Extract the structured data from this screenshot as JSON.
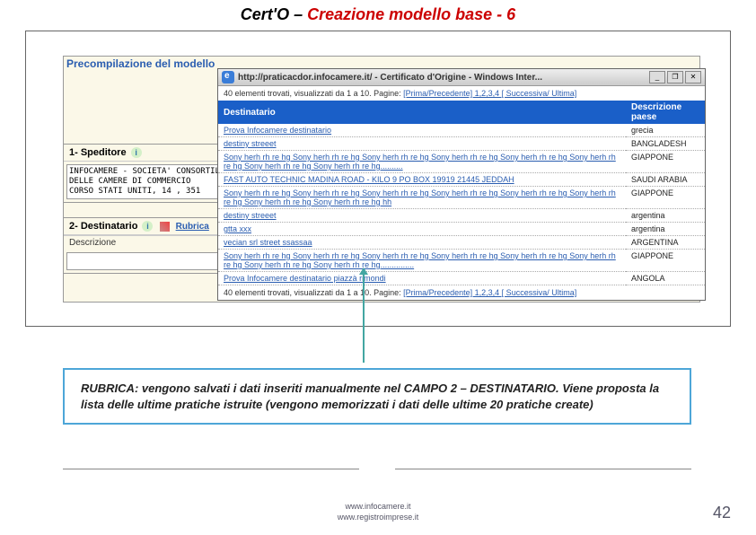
{
  "title": {
    "prefix": "Cert'O – ",
    "highlight": "Creazione modello base - 6"
  },
  "precomp_label": "Precompilazione del modello",
  "speditore": {
    "header": "1- Speditore",
    "value": "INFOCAMERE - SOCIETA' CONSORTILE\nDELLE CAMERE DI COMMERCIO\nCORSO STATI UNITI, 14 , 351"
  },
  "destinatario": {
    "header": "2- Destinatario",
    "rubrica_label": "Rubrica",
    "descrizione_label": "Descrizione"
  },
  "popup": {
    "title": "http://praticacdor.infocamere.it/ - Certificato d'Origine - Windows Inter...",
    "pager_pre": "40 elementi trovati, visualizzati da 1 a 10. Pagine: ",
    "pager_links": "[Prima/Precedente] 1,2,3,4 [ Successiva/ Ultima]",
    "col_dest": "Destinatario",
    "col_paese": "Descrizione paese",
    "rows": [
      {
        "dest": "Prova Infocamere destinatario",
        "paese": "grecia"
      },
      {
        "dest": "destiny streeet",
        "paese": "BANGLADESH"
      },
      {
        "dest": "Sony herh rh re hg Sony herh rh re hg Sony herh rh re hg Sony herh rh re hg Sony herh rh re hg Sony herh rh re hg Sony herh rh re hg Sony herh rh re hg..........",
        "paese": "GIAPPONE"
      },
      {
        "dest": "FAST AUTO TECHNIC MADINA ROAD - KILO 9 PO BOX 19919 21445 JEDDAH",
        "paese": "SAUDI ARABIA"
      },
      {
        "dest": "Sony herh rh re hg Sony herh rh re hg Sony herh rh re hg Sony herh rh re hg Sony herh rh re hg Sony herh rh re hg Sony herh rh re hg Sony herh rh re hg hh",
        "paese": "GIAPPONE"
      },
      {
        "dest": "destiny streeet",
        "paese": "argentina"
      },
      {
        "dest": "gtta xxx",
        "paese": "argentina"
      },
      {
        "dest": "vecian srl street ssassaa",
        "paese": "ARGENTINA"
      },
      {
        "dest": "Sony herh rh re hg Sony herh rh re hg Sony herh rh re hg Sony herh rh re hg Sony herh rh re hg Sony herh rh re hg Sony herh rh re hg Sony herh rh re hg...............",
        "paese": "GIAPPONE"
      },
      {
        "dest": "Prova Infocamere destinatario piazzà rimondi",
        "paese": "ANGOLA"
      }
    ]
  },
  "callout": "RUBRICA: vengono salvati i dati inseriti manualmente nel CAMPO 2 – DESTINATARIO. Viene proposta la lista delle ultime pratiche istruite (vengono memorizzati i dati delle ultime 20 pratiche create)",
  "footer": {
    "line1": "www.infocamere.it",
    "line2": "www.registroimprese.it"
  },
  "page_number": "42",
  "win_btns": {
    "min": "_",
    "max": "❐",
    "close": "✕"
  }
}
